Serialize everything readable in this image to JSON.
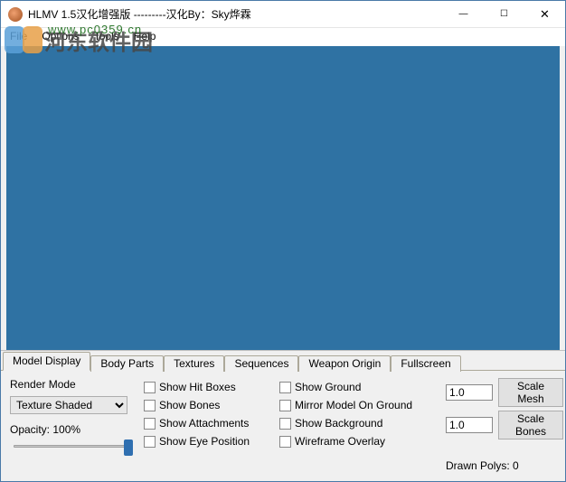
{
  "window": {
    "title": "HLMV 1.5汉化增强版 ---------汉化By：Sky烨霖"
  },
  "menu": {
    "file": "File",
    "options": "Options",
    "tools": "Tools",
    "help": "Help"
  },
  "watermark": {
    "text": "河东软件园",
    "url": "www.pc0359.cn"
  },
  "tabs": {
    "model_display": "Model Display",
    "body_parts": "Body Parts",
    "textures": "Textures",
    "sequences": "Sequences",
    "weapon_origin": "Weapon Origin",
    "fullscreen": "Fullscreen"
  },
  "render": {
    "mode_label": "Render Mode",
    "mode_value": "Texture Shaded",
    "opacity_label": "Opacity: 100%"
  },
  "checks": {
    "hit_boxes": "Show Hit Boxes",
    "bones": "Show Bones",
    "attachments": "Show Attachments",
    "eye_position": "Show Eye Position",
    "ground": "Show Ground",
    "mirror": "Mirror Model On Ground",
    "background": "Show Background",
    "wireframe": "Wireframe Overlay"
  },
  "scale": {
    "mesh_value": "1.0",
    "bones_value": "1.0",
    "mesh_btn": "Scale Mesh",
    "bones_btn": "Scale Bones"
  },
  "stats": {
    "drawn_polys": "Drawn Polys: 0"
  }
}
